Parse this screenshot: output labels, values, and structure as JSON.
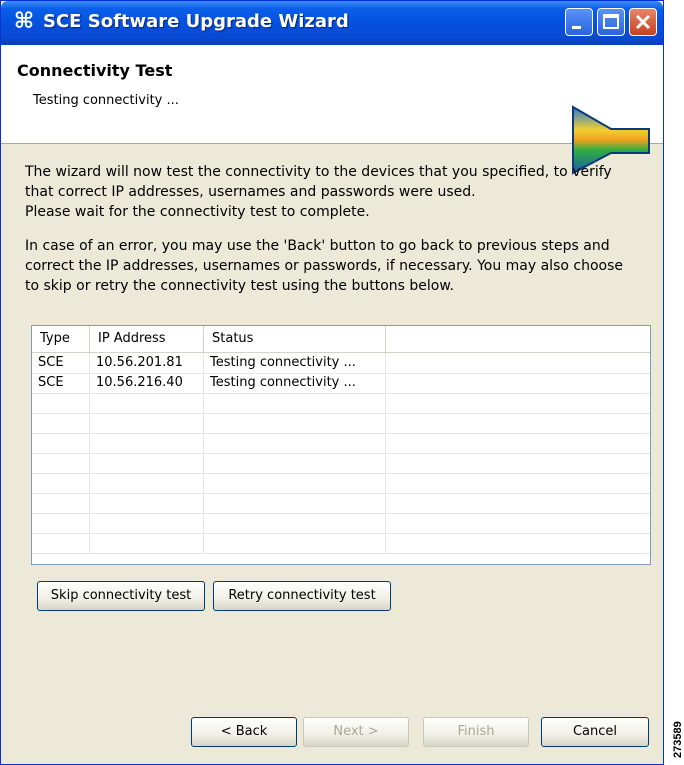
{
  "window": {
    "title": "SCE Software Upgrade Wizard",
    "icon": "wizard-icon"
  },
  "header": {
    "title": "Connectivity Test",
    "subtitle": "Testing connectivity ..."
  },
  "intro": {
    "line1": "The wizard will now test the connectivity to the devices that you specified, to verify",
    "line2": "that correct IP addresses, usernames and passwords were used.",
    "line3": "Please wait for the connectivity test to complete.",
    "line4": "In case of an error, you may use the 'Back' button to go back to previous steps and",
    "line5": "correct the IP addresses, usernames or passwords, if necessary. You may also choose",
    "line6": "to skip or retry the connectivity test using the buttons below."
  },
  "table": {
    "columns": [
      "Type",
      "IP Address",
      "Status"
    ],
    "rows": [
      [
        "SCE",
        "10.56.201.81",
        "Testing connectivity ..."
      ],
      [
        "SCE",
        "10.56.216.40",
        "Testing connectivity ..."
      ]
    ]
  },
  "actions": {
    "skip": "Skip connectivity test",
    "retry": "Retry connectivity test"
  },
  "nav": {
    "back": "< Back",
    "next": "Next >",
    "finish": "Finish",
    "cancel": "Cancel"
  },
  "figure_id": "273589",
  "colors": {
    "titlebar": "#0551e0",
    "dialog_bg": "#ece9d8",
    "table_border": "#7f9db9"
  }
}
